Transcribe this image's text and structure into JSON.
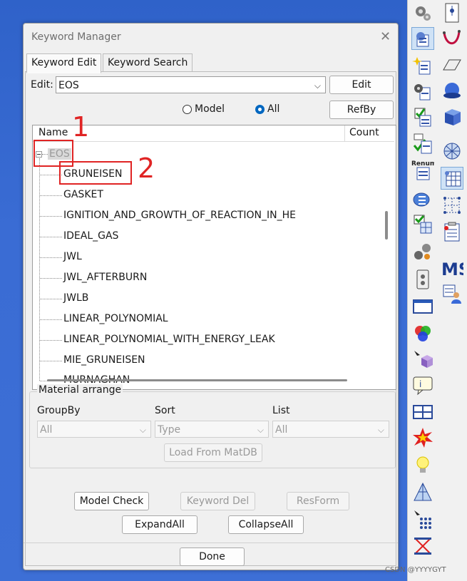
{
  "dialog": {
    "title": "Keyword Manager",
    "close_glyph": "✕",
    "tabs": [
      "Keyword Edit",
      "Keyword Search"
    ],
    "edit_label": "Edit:",
    "edit_value": "EOS",
    "edit_button": "Edit",
    "radio_model": "Model",
    "radio_all": "All",
    "radio_selected": "All",
    "refby_button": "RefBy",
    "tree": {
      "col_name": "Name",
      "col_count": "Count",
      "root": "EOS",
      "children": [
        "GRUNEISEN",
        "GASKET",
        "IGNITION_AND_GROWTH_OF_REACTION_IN_HE",
        "IDEAL_GAS",
        "JWL",
        "JWL_AFTERBURN",
        "JWLB",
        "LINEAR_POLYNOMIAL",
        "LINEAR_POLYNOMIAL_WITH_ENERGY_LEAK",
        "MIE_GRUNEISEN",
        "MURNAGHAN"
      ]
    },
    "annotations": [
      "1",
      "2"
    ],
    "material": {
      "title": "Material arrange",
      "groupby_label": "GroupBy",
      "sort_label": "Sort",
      "list_label": "List",
      "groupby_value": "All",
      "sort_value": "Type",
      "list_value": "All",
      "load_button": "Load From MatDB"
    },
    "buttons": {
      "model_check": "Model Check",
      "keyword_del": "Keyword Del",
      "resform": "ResForm",
      "expand_all": "ExpandAll",
      "collapse_all": "CollapseAll",
      "done": "Done"
    }
  },
  "toolbar": {
    "renum_label": "Renum",
    "ms_label": "MS"
  },
  "watermark": "CSDN @YYYYGYT",
  "colors": {
    "accent": "#0067c0",
    "annotation": "#e02424",
    "desktop": "#3a6cd4"
  }
}
